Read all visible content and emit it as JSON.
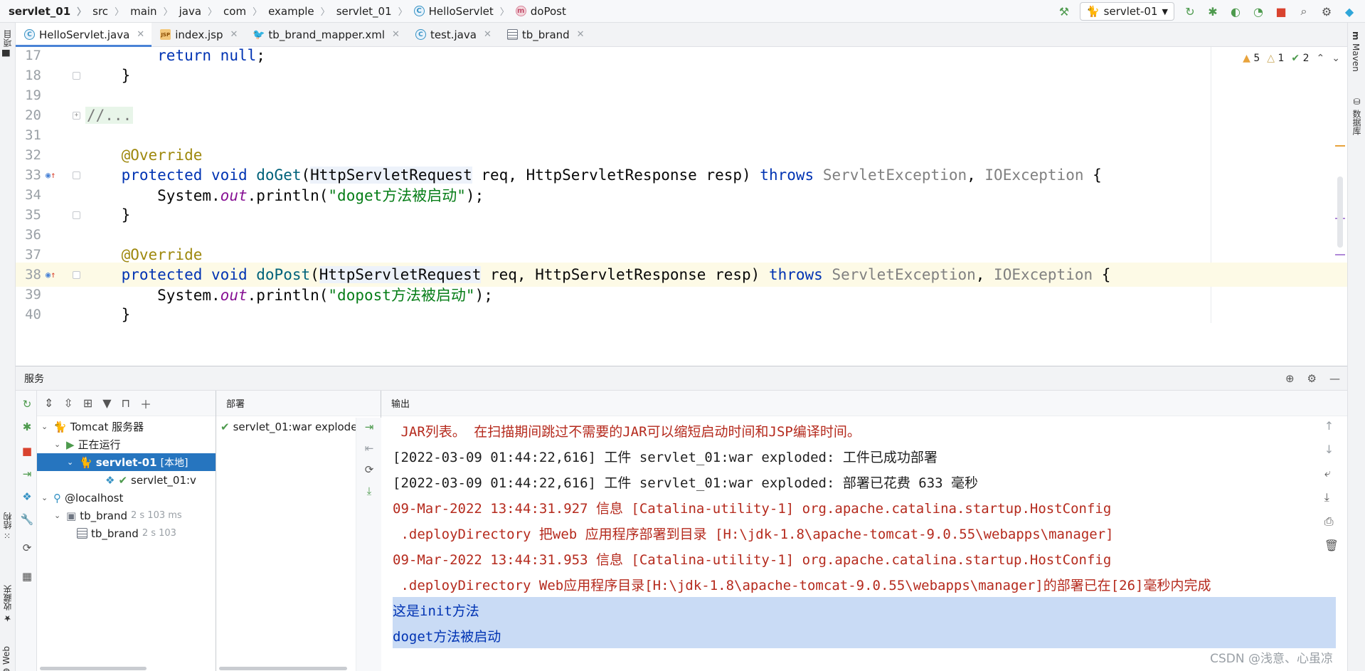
{
  "breadcrumb": {
    "items": [
      "servlet_01",
      "src",
      "main",
      "java",
      "com",
      "example",
      "servlet_01",
      "HelloServlet",
      "doPost"
    ]
  },
  "toolbar": {
    "run_config": "servlet-01"
  },
  "left_strip": {
    "project": "项目",
    "structure": "结构",
    "favorites": "收藏夹",
    "web": "Web"
  },
  "right_strip": {
    "maven": "Maven",
    "database": "数据库"
  },
  "tabs": [
    {
      "label": "HelloServlet.java",
      "type": "java"
    },
    {
      "label": "index.jsp",
      "type": "jsp"
    },
    {
      "label": "tb_brand_mapper.xml",
      "type": "xml"
    },
    {
      "label": "test.java",
      "type": "java"
    },
    {
      "label": "tb_brand",
      "type": "table"
    }
  ],
  "inspections": {
    "warnings": "5",
    "weak_warnings": "1",
    "ok": "2"
  },
  "editor": {
    "line_numbers": [
      "17",
      "18",
      "19",
      "20",
      "31",
      "32",
      "33",
      "34",
      "35",
      "36",
      "37",
      "38",
      "39",
      "40"
    ],
    "l17_kw": "return",
    "l17_kw2": "null",
    "l17_end": ";",
    "brace": "}",
    "folded": "//...",
    "annotation": "@Override",
    "protected": "protected",
    "void": "void",
    "doGet": "doGet",
    "doPost": "doPost",
    "paren_open": "(",
    "req_type": "HttpServletRequest",
    "req_rest": " req, HttpServletResponse resp) ",
    "throws": "throws",
    "exc1": "ServletException",
    "comma": ", ",
    "exc2": "IOException",
    "open_brace": " {",
    "system": "System.",
    "out": "out",
    "println": ".println(",
    "str_doget": "\"doget方法被启动\"",
    "str_dopost": "\"dopost方法被启动\"",
    "close_call": ");"
  },
  "services": {
    "title": "服务",
    "deploy_header": "部署",
    "output_header": "输出",
    "tree": {
      "tomcat": "Tomcat 服务器",
      "running": "正在运行",
      "server": "servlet-01",
      "server_tag": "[本地]",
      "artifact": "servlet_01:v",
      "localhost": "@localhost",
      "tb_brand_1": "tb_brand",
      "tb_brand_1_time": "2 s 103 ms",
      "tb_brand_2": "tb_brand",
      "tb_brand_2_time": "2 s 103"
    },
    "deploy_item": "servlet_01:war explode",
    "output": [
      " JAR列表。 在扫描期间跳过不需要的JAR可以缩短启动时间和JSP编译时间。",
      "[2022-03-09 01:44:22,616] 工件 servlet_01:war exploded: 工件已成功部署",
      "[2022-03-09 01:44:22,616] 工件 servlet_01:war exploded: 部署已花费 633 毫秒",
      "09-Mar-2022 13:44:31.927 信息 [Catalina-utility-1] org.apache.catalina.startup.HostConfig",
      " .deployDirectory 把web 应用程序部署到目录 [H:\\jdk-1.8\\apache-tomcat-9.0.55\\webapps\\manager]",
      "09-Mar-2022 13:44:31.953 信息 [Catalina-utility-1] org.apache.catalina.startup.HostConfig",
      " .deployDirectory Web应用程序目录[H:\\jdk-1.8\\apache-tomcat-9.0.55\\webapps\\manager]的部署已在[26]毫秒内完成",
      "这是init方法",
      "doget方法被启动"
    ]
  },
  "watermark": "CSDN @浅意、心虽凉",
  "colors": {
    "accent": "#2675bf",
    "keyword": "#0033b3",
    "string": "#067d17",
    "annotation": "#9e880d",
    "log_red": "#b52a1d",
    "selection": "#c9dbf5"
  }
}
